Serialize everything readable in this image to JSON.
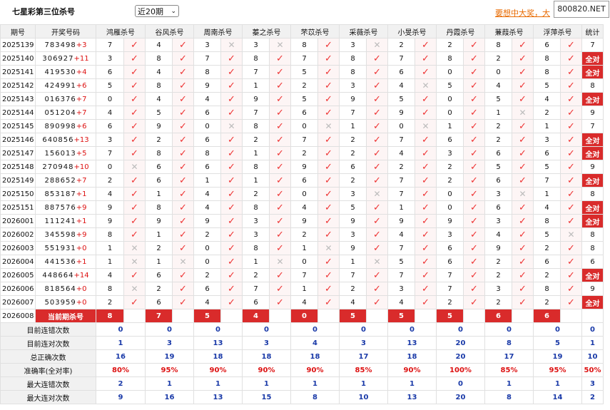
{
  "title": "七星彩第三位杀号",
  "period_select": "近20期",
  "promo": "要想中大奖，大",
  "watermark": "800820.NET",
  "headers": [
    "期号",
    "开奖号码",
    "鸿雁杀号",
    "谷风杀号",
    "周南杀号",
    "蓁之杀号",
    "芣苡杀号",
    "采薇杀号",
    "小旻杀号",
    "丹霞杀号",
    "蒹葭杀号",
    "浮萍杀号",
    "统计"
  ],
  "rows": [
    {
      "issue": "2025139",
      "draw": "783498",
      "plus": "+3",
      "kills": [
        "7",
        "4",
        "3",
        "3",
        "8",
        "3",
        "2",
        "2",
        "8",
        "6"
      ],
      "hits": [
        1,
        1,
        0,
        0,
        1,
        0,
        1,
        1,
        1,
        1
      ],
      "stat": "7"
    },
    {
      "issue": "2025140",
      "draw": "306927",
      "plus": "+11",
      "kills": [
        "3",
        "8",
        "7",
        "8",
        "7",
        "8",
        "7",
        "8",
        "2",
        "8"
      ],
      "hits": [
        1,
        1,
        1,
        1,
        1,
        1,
        1,
        1,
        1,
        1
      ],
      "stat": "全对"
    },
    {
      "issue": "2025141",
      "draw": "419530",
      "plus": "+4",
      "kills": [
        "6",
        "4",
        "8",
        "7",
        "5",
        "8",
        "6",
        "0",
        "0",
        "8"
      ],
      "hits": [
        1,
        1,
        1,
        1,
        1,
        1,
        1,
        1,
        1,
        1
      ],
      "stat": "全对"
    },
    {
      "issue": "2025142",
      "draw": "424991",
      "plus": "+6",
      "kills": [
        "5",
        "8",
        "9",
        "1",
        "2",
        "3",
        "4",
        "5",
        "4",
        "5"
      ],
      "hits": [
        1,
        1,
        1,
        1,
        1,
        1,
        0,
        1,
        1,
        1
      ],
      "stat": "8"
    },
    {
      "issue": "2025143",
      "draw": "016376",
      "plus": "+7",
      "kills": [
        "0",
        "4",
        "4",
        "9",
        "5",
        "9",
        "5",
        "0",
        "5",
        "4"
      ],
      "hits": [
        1,
        1,
        1,
        1,
        1,
        1,
        1,
        1,
        1,
        1
      ],
      "stat": "全对"
    },
    {
      "issue": "2025144",
      "draw": "051204",
      "plus": "+7",
      "kills": [
        "4",
        "5",
        "6",
        "7",
        "6",
        "7",
        "9",
        "0",
        "1",
        "2"
      ],
      "hits": [
        1,
        1,
        1,
        1,
        1,
        1,
        1,
        1,
        0,
        1
      ],
      "stat": "9"
    },
    {
      "issue": "2025145",
      "draw": "890998",
      "plus": "+6",
      "kills": [
        "6",
        "9",
        "0",
        "8",
        "0",
        "1",
        "0",
        "1",
        "2",
        "1"
      ],
      "hits": [
        1,
        1,
        0,
        1,
        0,
        1,
        0,
        1,
        1,
        1
      ],
      "stat": "7"
    },
    {
      "issue": "2025146",
      "draw": "640856",
      "plus": "+13",
      "kills": [
        "3",
        "2",
        "6",
        "2",
        "7",
        "2",
        "7",
        "6",
        "2",
        "3"
      ],
      "hits": [
        1,
        1,
        1,
        1,
        1,
        1,
        1,
        1,
        1,
        1
      ],
      "stat": "全对"
    },
    {
      "issue": "2025147",
      "draw": "156013",
      "plus": "+5",
      "kills": [
        "7",
        "8",
        "8",
        "1",
        "2",
        "2",
        "4",
        "3",
        "6",
        "6"
      ],
      "hits": [
        1,
        1,
        1,
        1,
        1,
        1,
        1,
        1,
        1,
        1
      ],
      "stat": "全对"
    },
    {
      "issue": "2025148",
      "draw": "270948",
      "plus": "+10",
      "kills": [
        "0",
        "6",
        "6",
        "8",
        "9",
        "6",
        "2",
        "2",
        "5",
        "5"
      ],
      "hits": [
        0,
        1,
        1,
        1,
        1,
        1,
        1,
        1,
        1,
        1
      ],
      "stat": "9"
    },
    {
      "issue": "2025149",
      "draw": "288652",
      "plus": "+7",
      "kills": [
        "2",
        "6",
        "1",
        "1",
        "6",
        "2",
        "7",
        "2",
        "6",
        "7"
      ],
      "hits": [
        1,
        1,
        1,
        1,
        1,
        1,
        1,
        1,
        1,
        1
      ],
      "stat": "全对"
    },
    {
      "issue": "2025150",
      "draw": "853187",
      "plus": "+1",
      "kills": [
        "4",
        "1",
        "4",
        "2",
        "0",
        "3",
        "7",
        "0",
        "3",
        "1"
      ],
      "hits": [
        1,
        1,
        1,
        1,
        1,
        0,
        1,
        1,
        0,
        1
      ],
      "stat": "8"
    },
    {
      "issue": "2025151",
      "draw": "887576",
      "plus": "+9",
      "kills": [
        "9",
        "8",
        "4",
        "8",
        "4",
        "5",
        "1",
        "0",
        "6",
        "4"
      ],
      "hits": [
        1,
        1,
        1,
        1,
        1,
        1,
        1,
        1,
        1,
        1
      ],
      "stat": "全对"
    },
    {
      "issue": "2026001",
      "draw": "111241",
      "plus": "+1",
      "kills": [
        "9",
        "9",
        "9",
        "3",
        "9",
        "9",
        "9",
        "9",
        "3",
        "8"
      ],
      "hits": [
        1,
        1,
        1,
        1,
        1,
        1,
        1,
        1,
        1,
        1
      ],
      "stat": "全对"
    },
    {
      "issue": "2026002",
      "draw": "345598",
      "plus": "+9",
      "kills": [
        "8",
        "1",
        "2",
        "3",
        "2",
        "3",
        "4",
        "3",
        "4",
        "5"
      ],
      "hits": [
        1,
        1,
        1,
        1,
        1,
        1,
        1,
        1,
        1,
        0
      ],
      "stat": "8"
    },
    {
      "issue": "2026003",
      "draw": "551931",
      "plus": "+0",
      "kills": [
        "1",
        "2",
        "0",
        "8",
        "1",
        "9",
        "7",
        "6",
        "9",
        "2"
      ],
      "hits": [
        0,
        1,
        1,
        1,
        0,
        1,
        1,
        1,
        1,
        1
      ],
      "stat": "8"
    },
    {
      "issue": "2026004",
      "draw": "441536",
      "plus": "+1",
      "kills": [
        "1",
        "1",
        "0",
        "1",
        "0",
        "1",
        "5",
        "6",
        "2",
        "6"
      ],
      "hits": [
        0,
        0,
        1,
        0,
        1,
        0,
        1,
        1,
        1,
        1
      ],
      "stat": "6"
    },
    {
      "issue": "2026005",
      "draw": "448664",
      "plus": "+14",
      "kills": [
        "4",
        "6",
        "2",
        "2",
        "7",
        "7",
        "7",
        "7",
        "2",
        "2"
      ],
      "hits": [
        1,
        1,
        1,
        1,
        1,
        1,
        1,
        1,
        1,
        1
      ],
      "stat": "全对"
    },
    {
      "issue": "2026006",
      "draw": "818564",
      "plus": "+0",
      "kills": [
        "8",
        "2",
        "6",
        "7",
        "1",
        "2",
        "3",
        "7",
        "3",
        "8"
      ],
      "hits": [
        0,
        1,
        1,
        1,
        1,
        1,
        1,
        1,
        1,
        1
      ],
      "stat": "9"
    },
    {
      "issue": "2026007",
      "draw": "503959",
      "plus": "+0",
      "kills": [
        "2",
        "6",
        "4",
        "6",
        "4",
        "4",
        "4",
        "2",
        "2",
        "2"
      ],
      "hits": [
        1,
        1,
        1,
        1,
        1,
        1,
        1,
        1,
        1,
        1
      ],
      "stat": "全对"
    }
  ],
  "current": {
    "issue": "2026008",
    "label": "当前期杀号",
    "kills": [
      "8",
      "7",
      "5",
      "4",
      "0",
      "5",
      "5",
      "5",
      "6",
      "6"
    ]
  },
  "stats": [
    {
      "label": "目前连错次数",
      "values": [
        "0",
        "0",
        "0",
        "0",
        "0",
        "0",
        "0",
        "0",
        "0",
        "0",
        "0"
      ],
      "rate": false
    },
    {
      "label": "目前连对次数",
      "values": [
        "1",
        "3",
        "13",
        "3",
        "4",
        "3",
        "13",
        "20",
        "8",
        "5",
        "1"
      ],
      "rate": false
    },
    {
      "label": "总正确次数",
      "values": [
        "16",
        "19",
        "18",
        "18",
        "18",
        "17",
        "18",
        "20",
        "17",
        "19",
        "10"
      ],
      "rate": false
    },
    {
      "label": "准确率(全对率)",
      "values": [
        "80%",
        "95%",
        "90%",
        "90%",
        "90%",
        "85%",
        "90%",
        "100%",
        "85%",
        "95%",
        "50%"
      ],
      "rate": true
    },
    {
      "label": "最大连错次数",
      "values": [
        "2",
        "1",
        "1",
        "1",
        "1",
        "1",
        "1",
        "0",
        "1",
        "1",
        "3"
      ],
      "rate": false
    },
    {
      "label": "最大连对次数",
      "values": [
        "9",
        "16",
        "13",
        "15",
        "8",
        "10",
        "13",
        "20",
        "8",
        "14",
        "2"
      ],
      "rate": false
    }
  ],
  "icons": {
    "hit": "check-icon",
    "miss": "cross-icon"
  },
  "colors": {
    "accent": "#d92b2b",
    "stat_blue": "#1a3aa8",
    "promo": "#e86a00"
  }
}
